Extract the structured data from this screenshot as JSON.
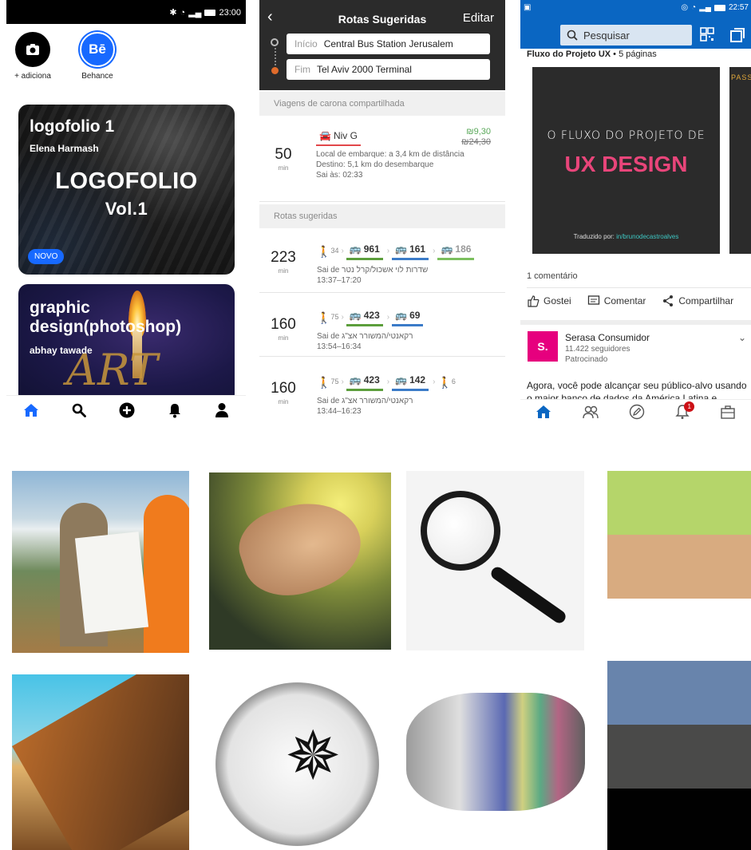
{
  "behance": {
    "status_time": "23:00",
    "stories": [
      {
        "label": "+ adiciona"
      },
      {
        "label": "Behance",
        "logo": "Bē"
      }
    ],
    "cards": [
      {
        "title": "logofolio 1",
        "author": "Elena Harmash",
        "cover_text_1": "LOGOFOLIO",
        "cover_text_2": "Vol.1",
        "badge": "NOVO"
      },
      {
        "title": "graphic design(photoshop)",
        "author": "abhay tawade",
        "cover_art_text": "ART"
      }
    ],
    "nav_icons": [
      "home-icon",
      "search-icon",
      "add-icon",
      "bell-icon",
      "profile-icon"
    ]
  },
  "transit": {
    "title": "Rotas Sugeridas",
    "edit_label": "Editar",
    "start_label": "Início",
    "start_value": "Central Bus Station Jerusalem",
    "end_label": "Fim",
    "end_value": "Tel Aviv 2000 Terminal",
    "rideshare_section": "Viagens de carona compartilhada",
    "rideshare": {
      "minutes": "50",
      "unit": "min",
      "operator": "Niv G",
      "price_new": "₪9,30",
      "price_old": "₪24,30",
      "line1": "Local de embarque: a 3,4 km de distância",
      "line2": "Destino: 5,1 km do desembarque",
      "line3": "Sai às: 02:33"
    },
    "routes_section": "Rotas sugeridas",
    "routes": [
      {
        "minutes": "223",
        "unit": "min",
        "walk": "34",
        "lines": [
          "961",
          "161",
          "186"
        ],
        "stop": "Sai de שדרות לוי אשכול/קרל נטר",
        "times": "13:37–17:20"
      },
      {
        "minutes": "160",
        "unit": "min",
        "walk": "75",
        "lines": [
          "423",
          "69"
        ],
        "stop": "Sai de רקאנטי/המשורר אצ\"ג",
        "times": "13:54–16:34"
      },
      {
        "minutes": "160",
        "unit": "min",
        "walk": "75",
        "lines": [
          "423",
          "142"
        ],
        "walk_end": "6",
        "stop": "Sai de רקאנטי/המשורר אצ\"ג",
        "times": "13:44–16:23"
      }
    ]
  },
  "linkedin": {
    "status_time": "22:57",
    "search_placeholder": "Pesquisar",
    "doc_title": "Fluxo do Projeto UX",
    "doc_pages": " • 5 páginas",
    "slide_line1": "O FLUXO DO PROJETO DE",
    "slide_line2": "UX DESIGN",
    "slide_credit_prefix": "Traduzido por: ",
    "slide_credit_handle": "in/brunodecastroalves",
    "next_slide_title": "PASS",
    "comments": "1 comentário",
    "actions": [
      "Gostei",
      "Comentar",
      "Compartilhar"
    ],
    "sponsor_name": "Serasa Consumidor",
    "sponsor_followers": "11.422 seguidores",
    "sponsor_tag": "Patrocinado",
    "post_text": "Agora, você pode alcançar seu público-alvo usando o maior banco de dados da América Latina e...",
    "notification_count": "1"
  },
  "gallery": {
    "swatch_colors_1": [
      "#b5d56a",
      "#d8ab80"
    ],
    "swatch_colors_2": [
      "#6884ac",
      "#4a4a49",
      "#010101"
    ]
  }
}
